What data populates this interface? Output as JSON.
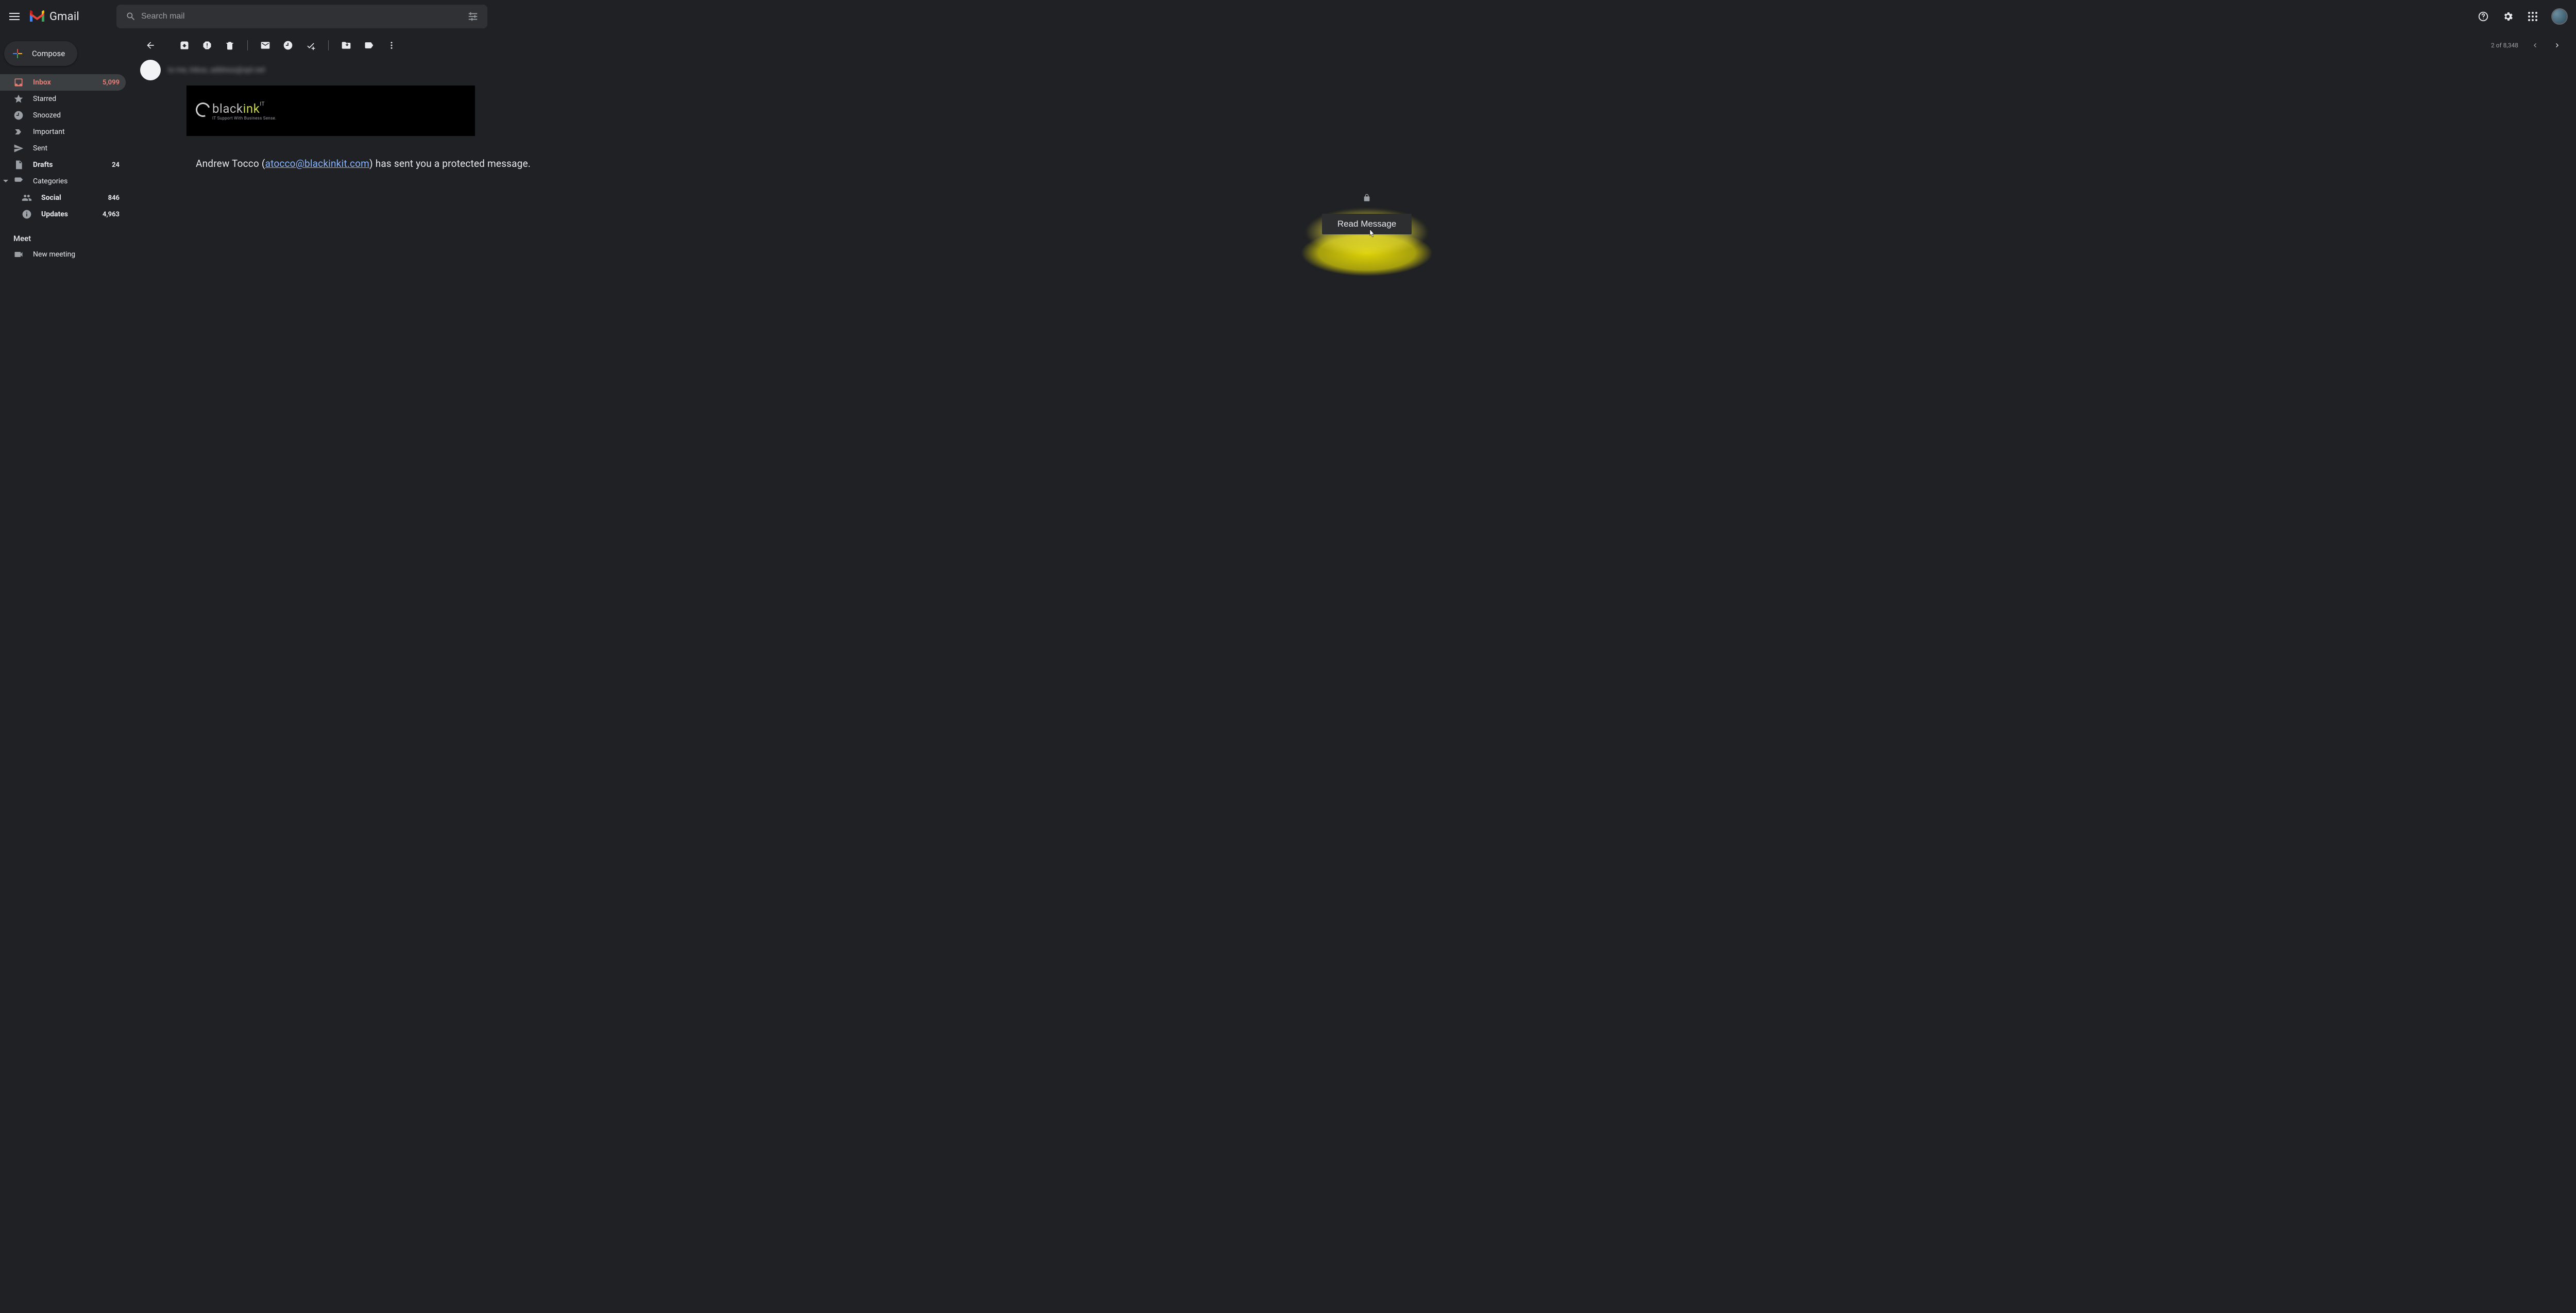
{
  "header": {
    "app_name": "Gmail",
    "search_placeholder": "Search mail"
  },
  "sidebar": {
    "compose_label": "Compose",
    "items": [
      {
        "id": "inbox",
        "label": "Inbox",
        "count": "5,099",
        "active": true,
        "bold": true
      },
      {
        "id": "starred",
        "label": "Starred",
        "count": "",
        "active": false,
        "bold": false
      },
      {
        "id": "snoozed",
        "label": "Snoozed",
        "count": "",
        "active": false,
        "bold": false
      },
      {
        "id": "important",
        "label": "Important",
        "count": "",
        "active": false,
        "bold": false
      },
      {
        "id": "sent",
        "label": "Sent",
        "count": "",
        "active": false,
        "bold": false
      },
      {
        "id": "drafts",
        "label": "Drafts",
        "count": "24",
        "active": false,
        "bold": true
      },
      {
        "id": "categories",
        "label": "Categories",
        "count": "",
        "active": false,
        "bold": false
      }
    ],
    "sub_items": [
      {
        "id": "social",
        "label": "Social",
        "count": "846",
        "bold": true
      },
      {
        "id": "updates",
        "label": "Updates",
        "count": "4,963",
        "bold": true
      }
    ],
    "meet_heading": "Meet",
    "meet_items": [
      {
        "id": "new-meeting",
        "label": "New meeting"
      }
    ]
  },
  "toolbar": {
    "pager": "2 of 8,348"
  },
  "message": {
    "sender_to_line": "to me, Inbox, address@opt.net",
    "banner": {
      "brand_part1": "black",
      "brand_part2": "ink",
      "brand_sup": "IT",
      "tagline": "IT Support With Business Sense."
    },
    "protected_prefix": "Andrew Tocco (",
    "protected_email": "atocco@blackinkit.com",
    "protected_suffix": ") has sent you a protected message.",
    "read_button": "Read Message"
  }
}
